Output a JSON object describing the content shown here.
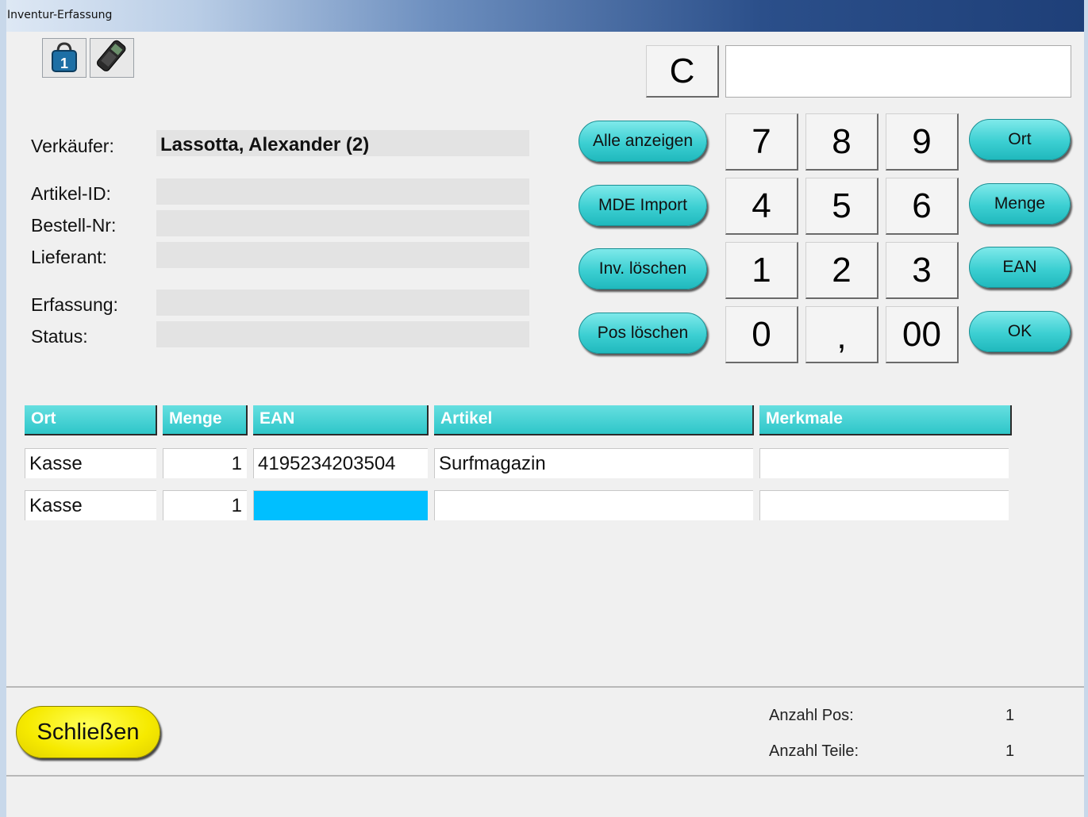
{
  "window": {
    "title": "Inventur-Erfassung"
  },
  "toolbar": {
    "icons": [
      "shopping-bag-icon",
      "handheld-scanner-icon"
    ],
    "bag_number": "1"
  },
  "form": {
    "verkaeufer_label": "Verkäufer:",
    "verkaeufer_value": "Lassotta, Alexander (2)",
    "artikel_id_label": "Artikel-ID:",
    "bestell_nr_label": "Bestell-Nr:",
    "lieferant_label": "Lieferant:",
    "erfassung_label": "Erfassung:",
    "status_label": "Status:"
  },
  "actions": {
    "alle_anzeigen": "Alle anzeigen",
    "mde_import": "MDE Import",
    "inv_loeschen": "Inv. löschen",
    "pos_loeschen": "Pos löschen"
  },
  "keypad": {
    "clear": "C",
    "display_value": "",
    "k7": "7",
    "k8": "8",
    "k9": "9",
    "k4": "4",
    "k5": "5",
    "k6": "6",
    "k1": "1",
    "k2": "2",
    "k3": "3",
    "k0": "0",
    "kcomma": ",",
    "k00": "00"
  },
  "modes": {
    "ort": "Ort",
    "menge": "Menge",
    "ean": "EAN",
    "ok": "OK"
  },
  "table": {
    "headers": {
      "ort": "Ort",
      "menge": "Menge",
      "ean": "EAN",
      "artikel": "Artikel",
      "merkmale": "Merkmale"
    },
    "rows": [
      {
        "ort": "Kasse",
        "menge": "1",
        "ean": "4195234203504",
        "artikel": "Surfmagazin",
        "merkmale": ""
      },
      {
        "ort": "Kasse",
        "menge": "1",
        "ean": "",
        "artikel": "",
        "merkmale": ""
      }
    ]
  },
  "footer": {
    "close_label": "Schließen",
    "anzahl_pos_label": "Anzahl Pos:",
    "anzahl_pos_value": "1",
    "anzahl_teile_label": "Anzahl Teile:",
    "anzahl_teile_value": "1"
  },
  "colors": {
    "accent": "#2ec6c9",
    "selected_cell": "#00bfff",
    "close_button": "#f6ea00"
  }
}
